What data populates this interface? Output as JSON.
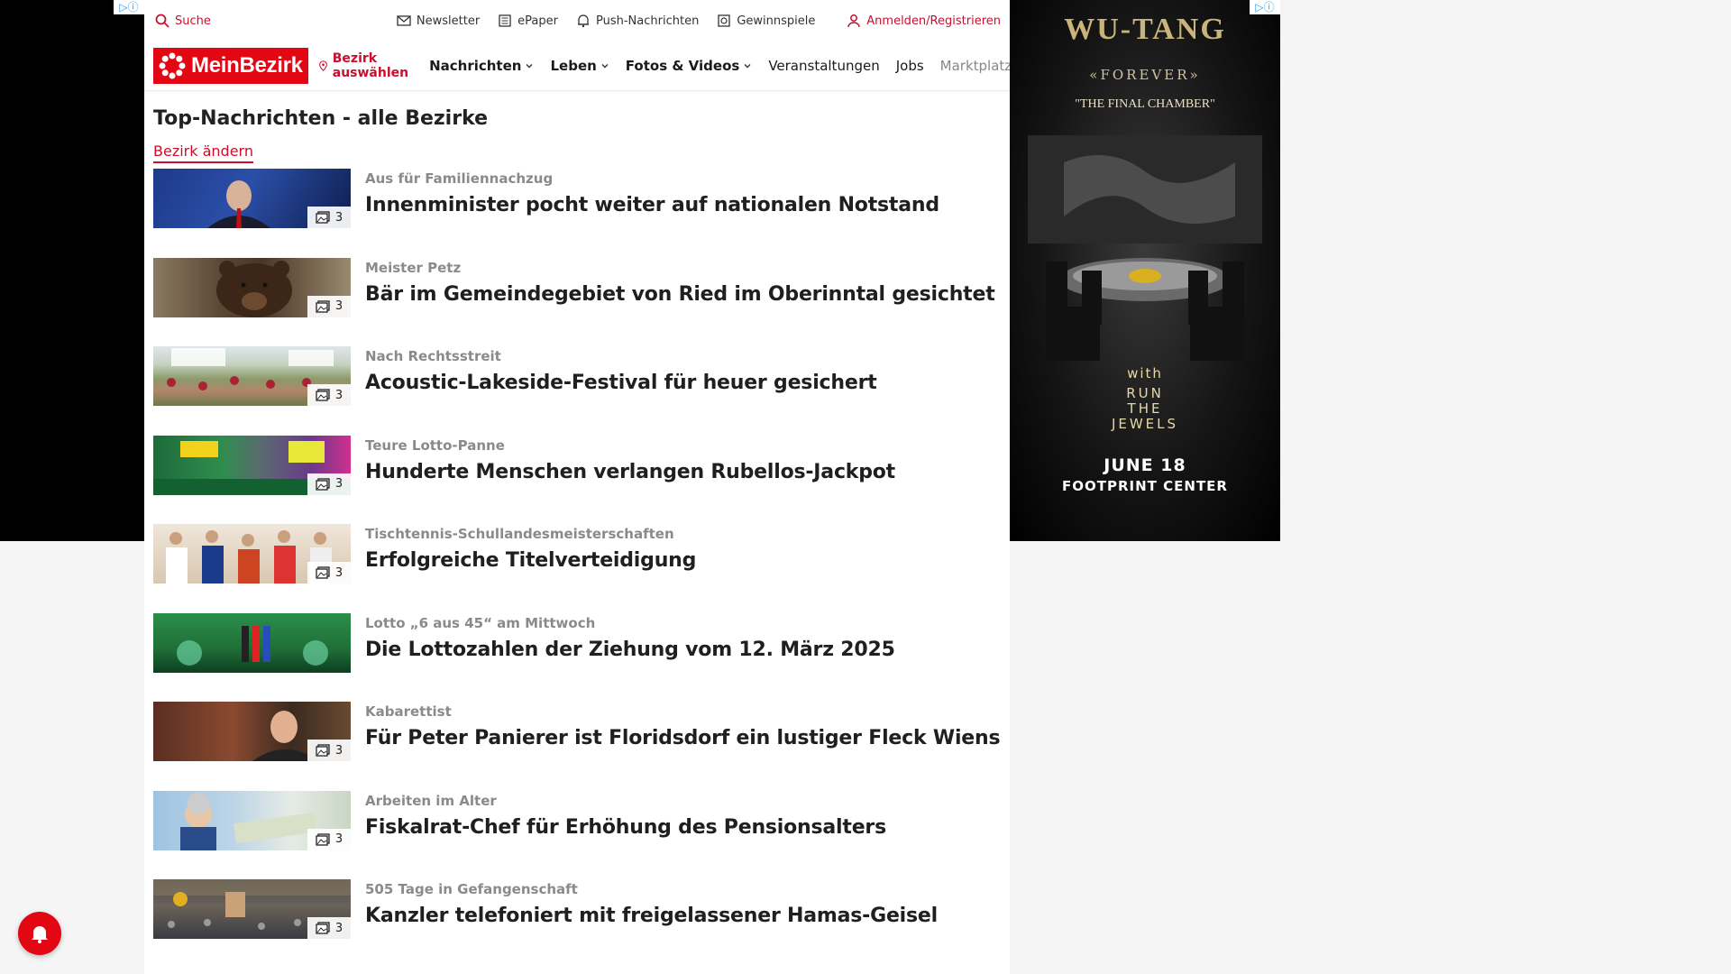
{
  "util": {
    "search": "Suche",
    "newsletter": "Newsletter",
    "epaper": "ePaper",
    "push": "Push-Nachrichten",
    "games": "Gewinnspiele",
    "login": "Anmelden/Registrieren"
  },
  "nav": {
    "logo": "MeinBezirk",
    "district": "Bezirk auswählen",
    "items": [
      "Nachrichten",
      "Leben",
      "Fotos & Videos",
      "Veranstaltungen",
      "Jobs",
      "Marktplatz"
    ]
  },
  "main": {
    "title": "Top-Nachrichten - alle Bezirke",
    "change_district": "Bezirk ändern",
    "articles": [
      {
        "kicker": "Aus für Familiennachzug",
        "headline": "Innenminister pocht weiter auf nationalen Notstand",
        "count": "3"
      },
      {
        "kicker": "Meister Petz",
        "headline": "Bär im Gemeindegebiet von Ried im Oberinntal gesichtet",
        "count": "3"
      },
      {
        "kicker": "Nach Rechtsstreit",
        "headline": "Acoustic-Lakeside-Festival für heuer gesichert",
        "count": "3"
      },
      {
        "kicker": "Teure Lotto-Panne",
        "headline": "Hunderte Menschen verlangen Rubellos-Jackpot",
        "count": "3"
      },
      {
        "kicker": "Tischtennis-Schullandesmeisterschaften",
        "headline": "Erfolgreiche Titelverteidigung",
        "count": "3"
      },
      {
        "kicker": "Lotto „6 aus 45“ am Mittwoch",
        "headline": "Die Lottozahlen der Ziehung vom 12. März 2025",
        "count": ""
      },
      {
        "kicker": "Kabarettist",
        "headline": "Für Peter Panierer ist Floridsdorf ein lustiger Fleck Wiens",
        "count": "3"
      },
      {
        "kicker": "Arbeiten im Alter",
        "headline": "Fiskalrat-Chef für Erhöhung des Pensionsalters",
        "count": "3"
      },
      {
        "kicker": "505 Tage in Gefangenschaft",
        "headline": "Kanzler telefoniert mit freigelassener Hamas-Geisel",
        "count": "3"
      }
    ]
  },
  "ad": {
    "logo": "WU-TANG",
    "forever": "«FOREVER»",
    "subtitle": "\"THE FINAL CHAMBER\"",
    "with": "with",
    "rtj": [
      "RUN",
      "THE",
      "JEWELS"
    ],
    "date": "JUNE 18",
    "venue": "FOOTPRINT CENTER"
  },
  "colors": {
    "brand": "#e30613",
    "accent": "#c8102e",
    "kicker": "#8a8a8a"
  }
}
